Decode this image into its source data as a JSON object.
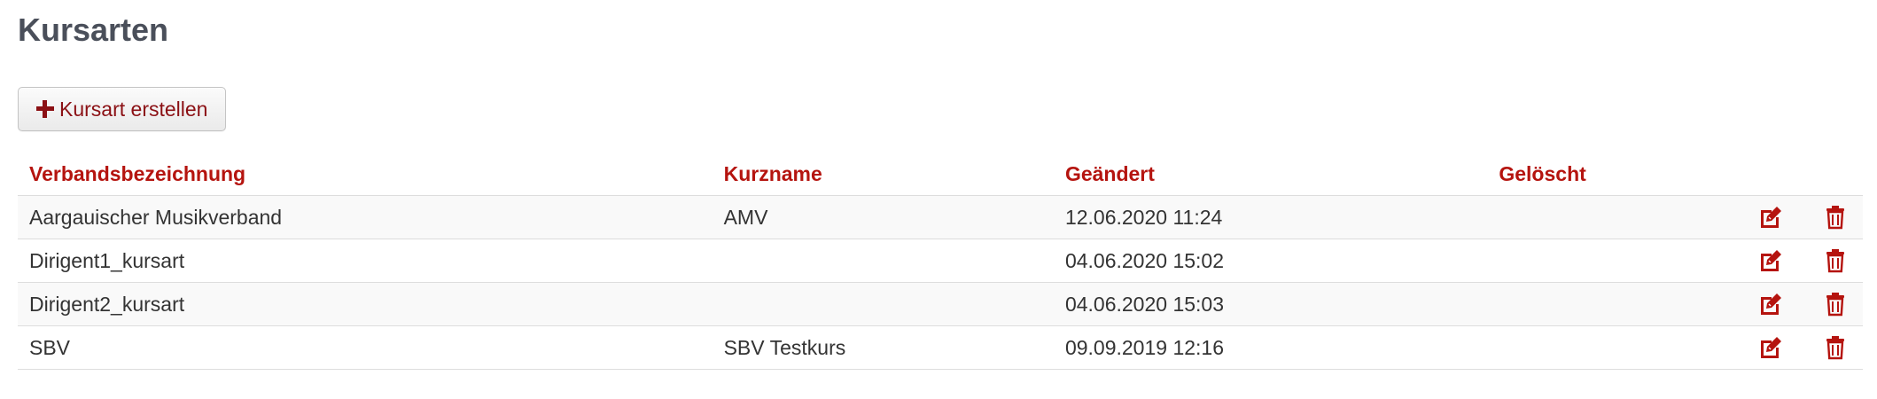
{
  "page": {
    "title": "Kursarten"
  },
  "toolbar": {
    "create_label": "Kursart erstellen"
  },
  "table": {
    "columns": [
      "Verbandsbezeichnung",
      "Kurzname",
      "Geändert",
      "Gelöscht"
    ],
    "rows": [
      {
        "verband": "Aargauischer Musikverband",
        "kurzname": "AMV",
        "geaendert": "12.06.2020 11:24",
        "geloescht": ""
      },
      {
        "verband": "Dirigent1_kursart",
        "kurzname": "",
        "geaendert": "04.06.2020 15:02",
        "geloescht": ""
      },
      {
        "verband": "Dirigent2_kursart",
        "kurzname": "",
        "geaendert": "04.06.2020 15:03",
        "geloescht": ""
      },
      {
        "verband": "SBV",
        "kurzname": "SBV Testkurs",
        "geaendert": "09.09.2019 12:16",
        "geloescht": ""
      }
    ]
  },
  "icons": {
    "create": "plus-icon",
    "edit": "edit-icon",
    "delete": "trash-icon"
  },
  "colors": {
    "accent": "#b5140f",
    "title": "#4a4f5a",
    "row_stripe": "#f9f9f9"
  }
}
